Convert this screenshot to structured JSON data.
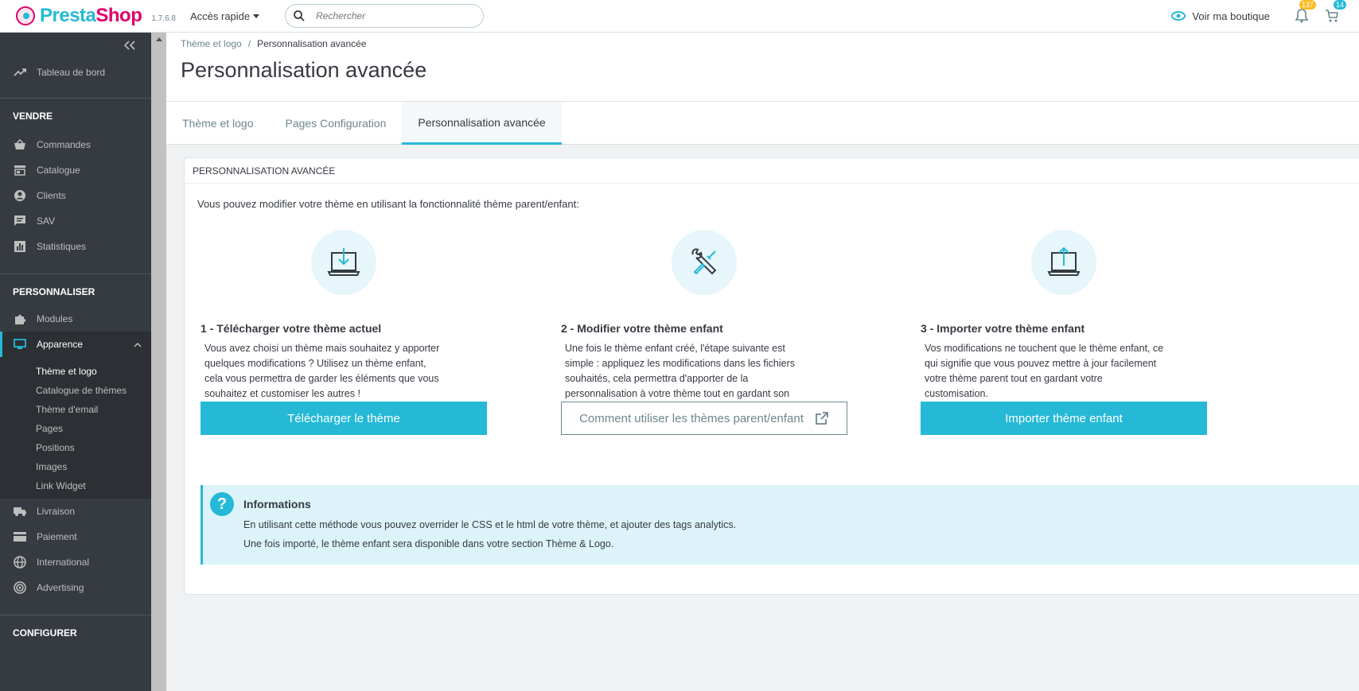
{
  "header": {
    "brand_part1": "Presta",
    "brand_part2": "Shop",
    "version": "1.7.6.8",
    "quick_access": "Accès rapide",
    "search_placeholder": "Rechercher",
    "view_shop": "Voir ma boutique",
    "notifications_count": "137",
    "cart_count": "14",
    "colors": {
      "primary": "#25b9d7",
      "brand_pink": "#df0067",
      "badge_orange": "#fbbb22"
    }
  },
  "sidebar": {
    "dashboard": "Tableau de bord",
    "section_sell": "VENDRE",
    "sell_items": [
      "Commandes",
      "Catalogue",
      "Clients",
      "SAV",
      "Statistiques"
    ],
    "section_customize": "PERSONNALISER",
    "modules": "Modules",
    "appearance": "Apparence",
    "appearance_sub": [
      "Thème et logo",
      "Catalogue de thèmes",
      "Thème d'email",
      "Pages",
      "Positions",
      "Images",
      "Link Widget"
    ],
    "after_items": [
      "Livraison",
      "Paiement",
      "International",
      "Advertising"
    ],
    "section_configure": "CONFIGURER"
  },
  "breadcrumb": {
    "parent": "Thème et logo",
    "separator": "/",
    "current": "Personnalisation avancée"
  },
  "page_title": "Personnalisation avancée",
  "tabs": [
    "Thème et logo",
    "Pages Configuration",
    "Personnalisation avancée"
  ],
  "panel": {
    "heading": "PERSONNALISATION AVANCÉE",
    "intro": "Vous pouvez modifier votre thème en utilisant la fonctionnalité thème parent/enfant:",
    "steps": [
      {
        "title": "1 - Télécharger votre thème actuel",
        "text": "Vous avez choisi un thème mais souhaitez y apporter quelques modifications ? Utilisez un thème enfant, cela vous permettra de garder les éléments que vous souhaitez et customiser les autres !",
        "button": "Télécharger le thème",
        "icon": "laptop-download-icon"
      },
      {
        "title": "2 - Modifier votre thème enfant",
        "text": "Une fois le thème enfant créé, l'étape suivante est simple : appliquez les modifications dans les fichiers souhaités, cela permettra d'apporter de la personnalisation à votre thème tout en gardant son style et ses fonctionnalités.",
        "button": "Comment utiliser les thèmes parent/enfant",
        "icon": "tools-icon"
      },
      {
        "title": "3 - Importer votre thème enfant",
        "text": "Vos modifications ne touchent que le thème enfant, ce qui signifie que vous pouvez mettre à jour facilement votre thème parent tout en gardant votre customisation.",
        "button": "Importer thème enfant",
        "icon": "laptop-upload-icon"
      }
    ],
    "info": {
      "icon": "?",
      "title": "Informations",
      "line1": "En utilisant cette méthode vous pouvez overrider le CSS et le html de votre thème, et ajouter des tags analytics.",
      "line2": "Une fois importé, le thème enfant sera disponible dans votre section Thème & Logo."
    }
  }
}
